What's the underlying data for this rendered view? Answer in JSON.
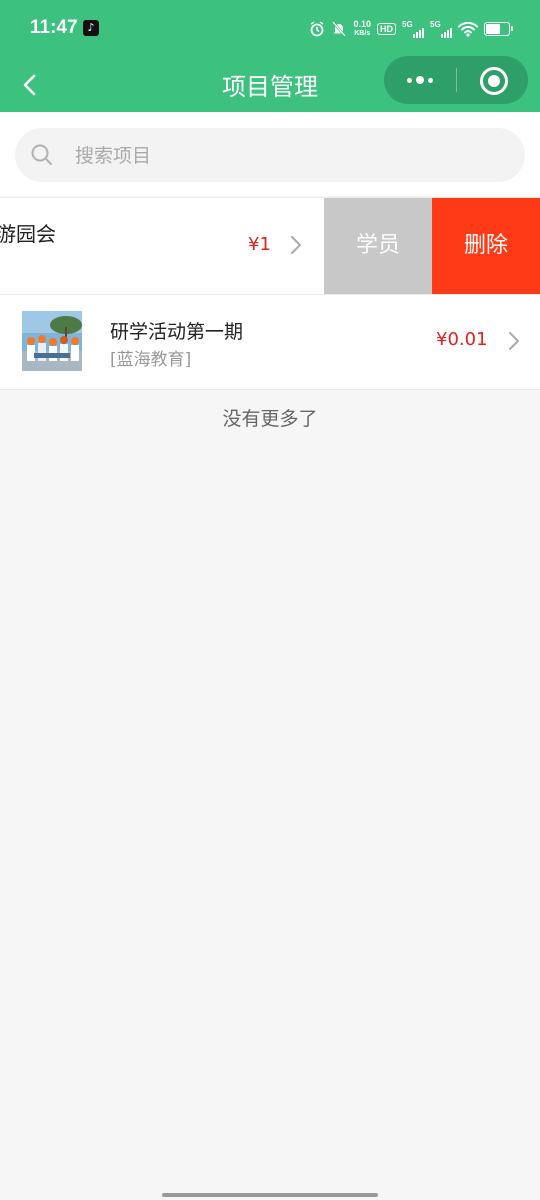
{
  "status_bar": {
    "time": "11:47",
    "net_speed_value": "0.10",
    "net_speed_unit": "KB/s",
    "hd_badge": "HD",
    "signal1_label": "5G",
    "signal2_label": "5G"
  },
  "nav": {
    "title": "项目管理"
  },
  "search": {
    "placeholder": "搜索项目"
  },
  "projects": [
    {
      "title": "游园会",
      "price": "¥1",
      "actions": {
        "student_label": "学员",
        "delete_label": "删除"
      }
    },
    {
      "title": "研学活动第一期",
      "organization": "[蓝海教育]",
      "price": "¥0.01"
    }
  ],
  "list_footer": "没有更多了",
  "colors": {
    "header_green": "#3cc17f",
    "capsule_green": "#2e9f68",
    "price_red": "#dd2222",
    "delete_red": "#ff3b17",
    "student_gray": "#c8c8c8"
  },
  "icons": {
    "back": "chevron-left-icon",
    "more": "more-dots-icon",
    "close": "target-close-icon",
    "search": "search-icon",
    "row_arrow": "chevron-right-icon"
  }
}
